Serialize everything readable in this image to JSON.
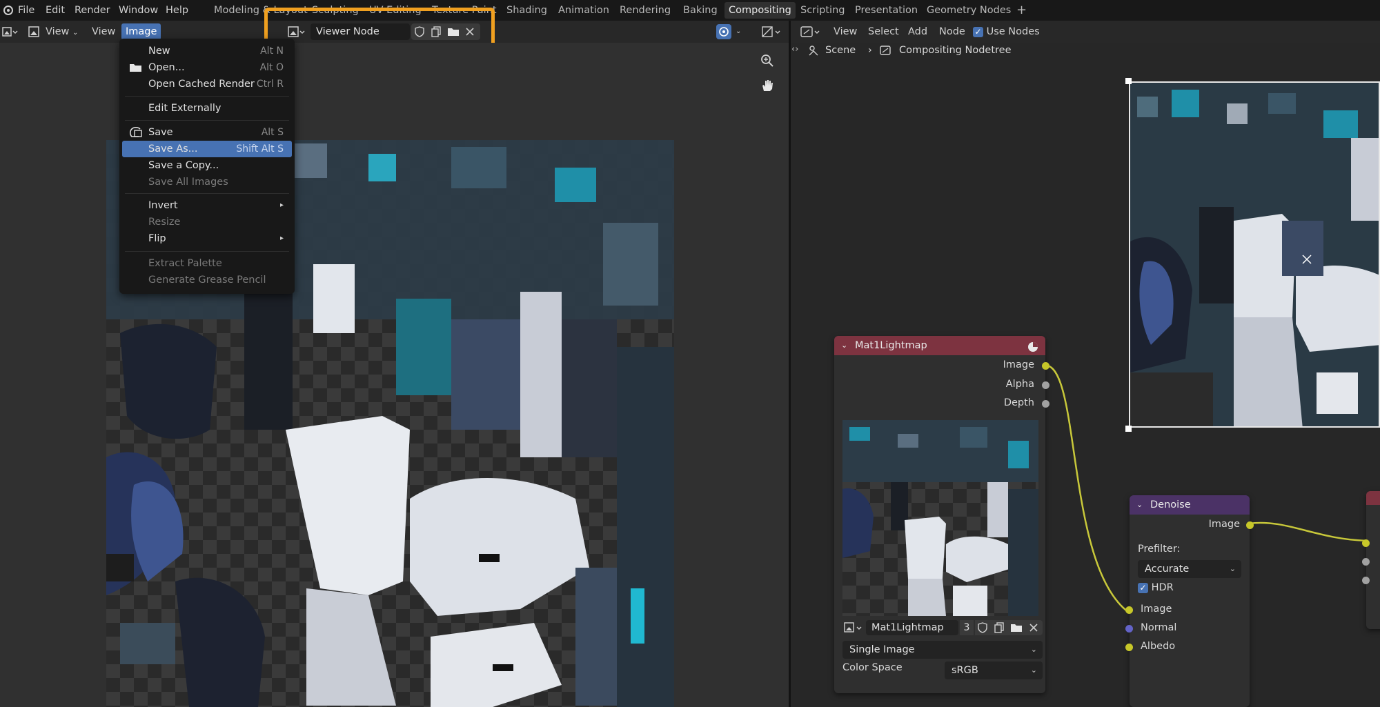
{
  "menubar": {
    "items": [
      "File",
      "Edit",
      "Render",
      "Window",
      "Help"
    ]
  },
  "workspaces": {
    "tabs": [
      "Modeling & Layout",
      "Sculpting",
      "UV Editing",
      "Texture Paint",
      "Shading",
      "Animation",
      "Rendering",
      "Baking",
      "Compositing",
      "Scripting",
      "Presentation",
      "Geometry Nodes"
    ],
    "active": "Compositing",
    "add_label": "+"
  },
  "image_editor": {
    "view_mode": "View",
    "view_menu": "View",
    "image_menu": "Image",
    "image_name": "Viewer Node"
  },
  "image_menu": {
    "items": [
      {
        "label": "New",
        "shortcut": "Alt N",
        "icon": "none",
        "enabled": true
      },
      {
        "label": "Open...",
        "shortcut": "Alt O",
        "icon": "folder-icon",
        "enabled": true
      },
      {
        "label": "Open Cached Render",
        "shortcut": "Ctrl R",
        "icon": "none",
        "enabled": true
      },
      {
        "label": "Edit Externally",
        "shortcut": "",
        "icon": "none",
        "enabled": true
      },
      {
        "label": "Save",
        "shortcut": "Alt S",
        "icon": "save-icon",
        "enabled": true
      },
      {
        "label": "Save As...",
        "shortcut": "Shift Alt S",
        "icon": "none",
        "enabled": true,
        "highlighted": true
      },
      {
        "label": "Save a Copy...",
        "shortcut": "",
        "icon": "none",
        "enabled": true
      },
      {
        "label": "Save All Images",
        "shortcut": "",
        "icon": "none",
        "enabled": false
      },
      {
        "label": "Invert",
        "shortcut": "",
        "icon": "none",
        "enabled": true,
        "submenu": true
      },
      {
        "label": "Resize",
        "shortcut": "",
        "icon": "none",
        "enabled": false
      },
      {
        "label": "Flip",
        "shortcut": "",
        "icon": "none",
        "enabled": true,
        "submenu": true
      },
      {
        "label": "Extract Palette",
        "shortcut": "",
        "icon": "none",
        "enabled": false
      },
      {
        "label": "Generate Grease Pencil",
        "shortcut": "",
        "icon": "none",
        "enabled": false
      }
    ]
  },
  "node_editor": {
    "header": {
      "view": "View",
      "select": "Select",
      "add": "Add",
      "node": "Node",
      "use_nodes": "Use Nodes"
    },
    "breadcrumb": {
      "scene": "Scene",
      "tree": "Compositing Nodetree"
    },
    "image_node": {
      "title": "Mat1Lightmap",
      "outputs": [
        "Image",
        "Alpha",
        "Depth"
      ],
      "image_name": "Mat1Lightmap",
      "users": "3",
      "source": "Single Image",
      "color_space_label": "Color Space",
      "color_space": "sRGB"
    },
    "denoise_node": {
      "title": "Denoise",
      "output": "Image",
      "prefilter_label": "Prefilter:",
      "prefilter": "Accurate",
      "hdr_label": "HDR",
      "inputs": [
        "Image",
        "Normal",
        "Albedo"
      ]
    }
  },
  "colors": {
    "accent": "#4772b3",
    "highlight_box": "#f0a020",
    "image_node_header": "#7d3340",
    "denoise_header": "#4b3266",
    "link": "#c8c83a",
    "socket_yellow": "#c7c729",
    "socket_gray": "#a1a1a1",
    "socket_purple": "#6363c7"
  }
}
